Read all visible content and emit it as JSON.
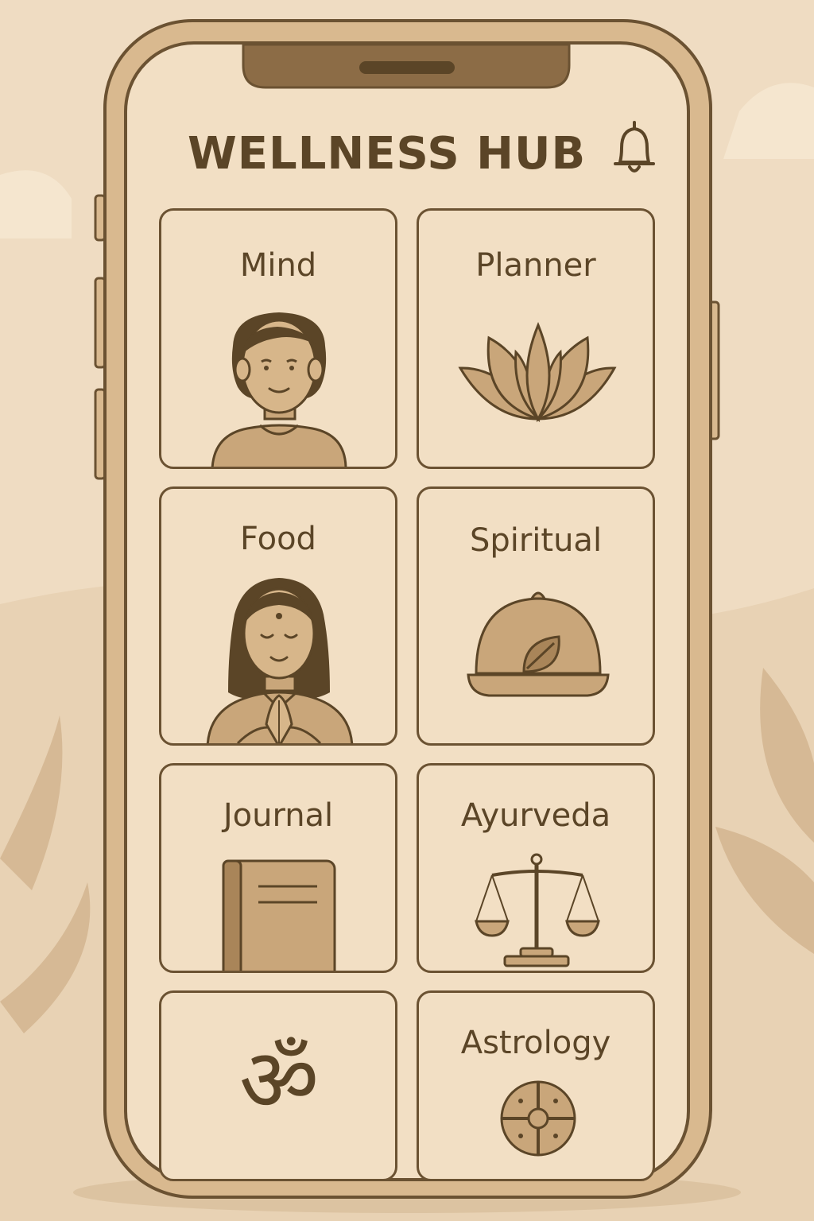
{
  "header": {
    "title": "WELLNESS HUB",
    "notification_icon": "bell-icon"
  },
  "tiles": [
    {
      "label": "Mind",
      "icon": "woman-portrait-icon"
    },
    {
      "label": "Planner",
      "icon": "lotus-icon"
    },
    {
      "label": "Food",
      "icon": "praying-woman-icon"
    },
    {
      "label": "Spiritual",
      "icon": "covered-dish-icon"
    },
    {
      "label": "Journal",
      "icon": "book-icon"
    },
    {
      "label": "Ayurveda",
      "icon": "balance-scale-icon"
    },
    {
      "label": "",
      "icon": "om-symbol-icon"
    },
    {
      "label": "Astrology",
      "icon": "zodiac-wheel-icon"
    }
  ],
  "colors": {
    "background": "#efdcc2",
    "phone_frame": "#d9b98f",
    "screen": "#f2dfc4",
    "outline": "#6b5232",
    "icon_fill": "#c9a67a",
    "text": "#5b4527"
  }
}
